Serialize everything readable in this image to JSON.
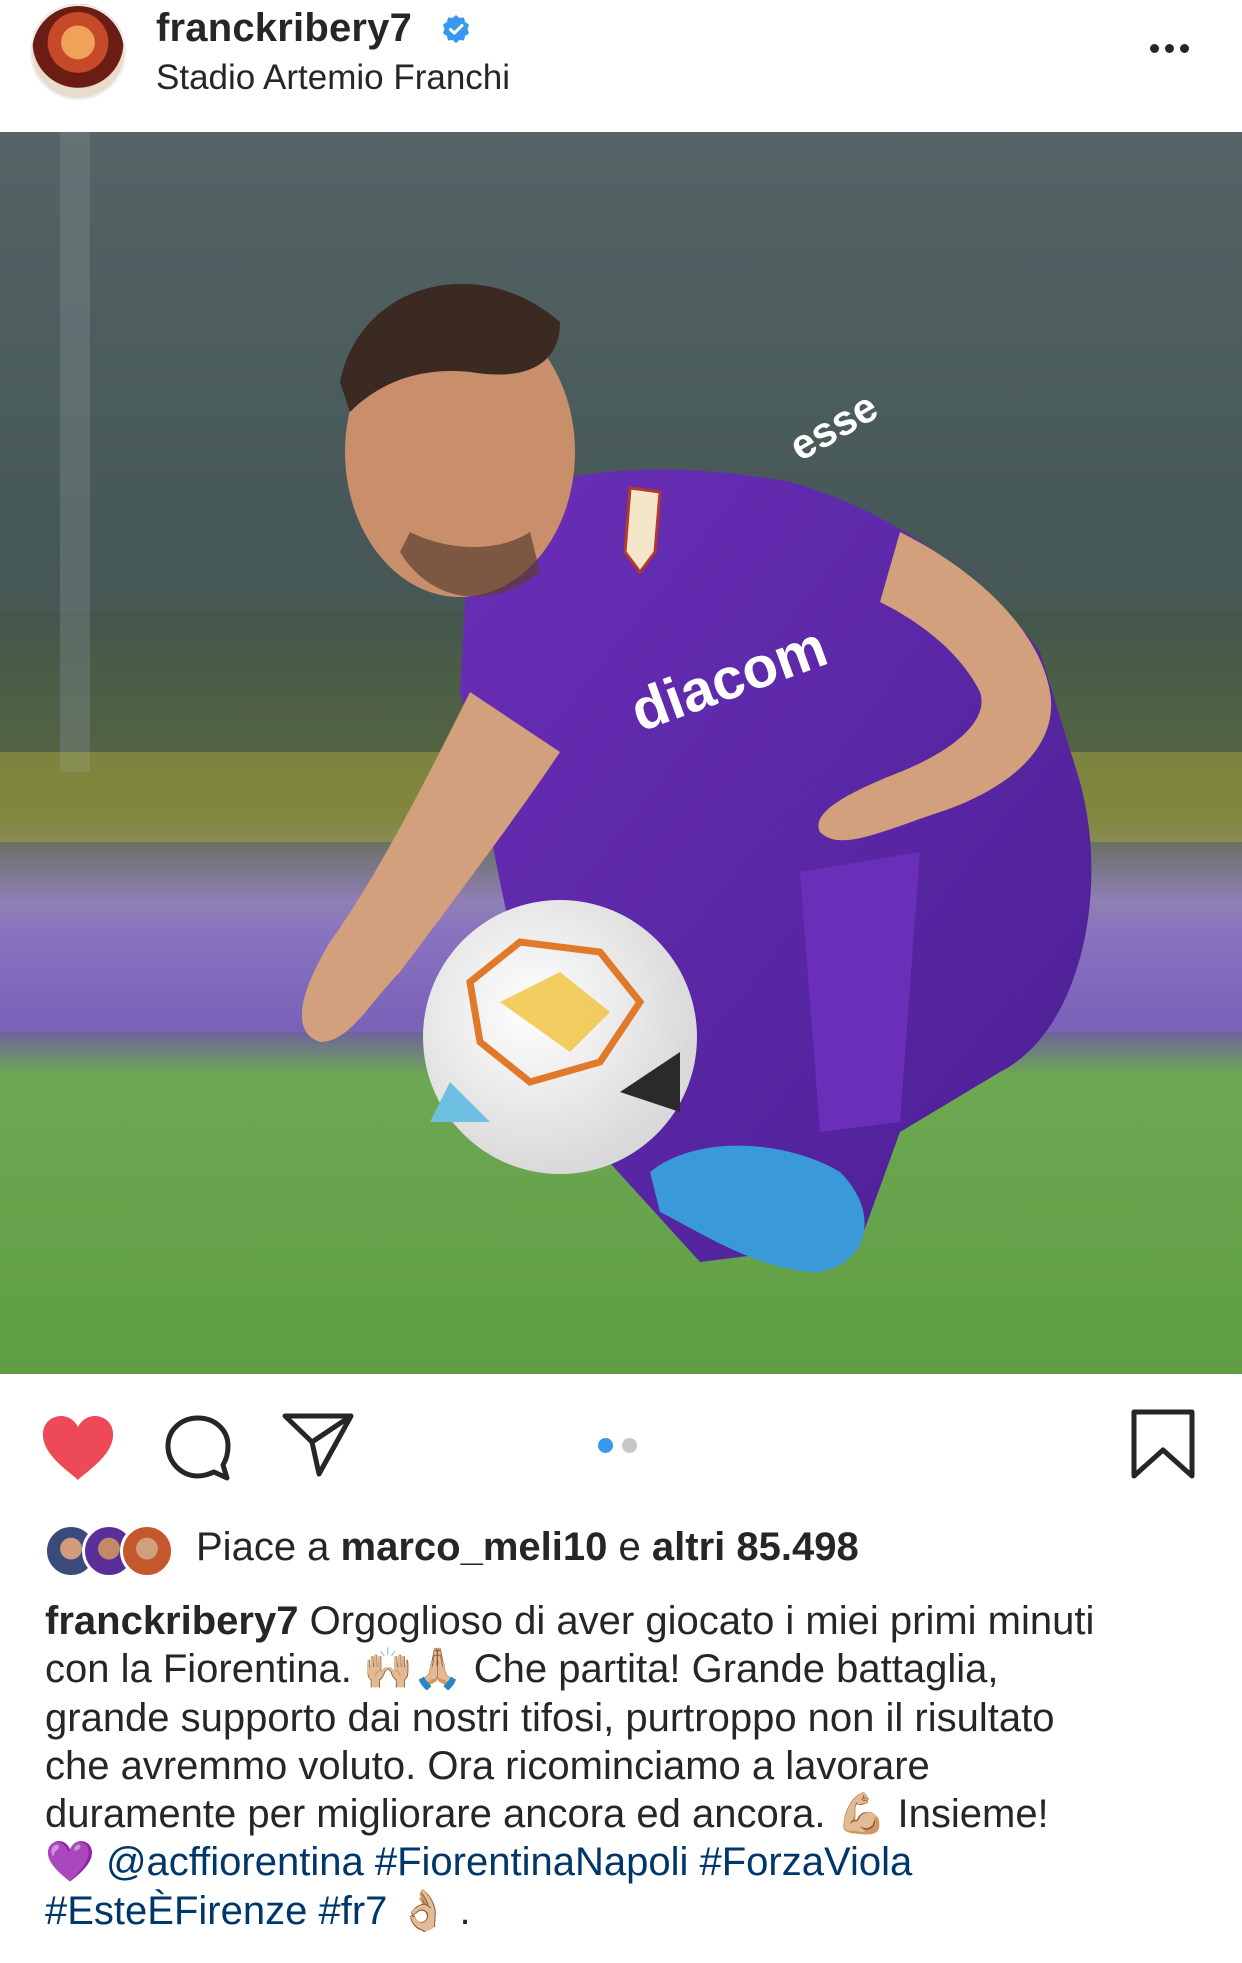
{
  "header": {
    "username": "franckribery7",
    "location": "Stadio Artemio Franchi",
    "verified": true
  },
  "post": {
    "photo_count": 2,
    "active_photo_index": 0,
    "liked": true,
    "colors": {
      "like_red": "#ed4956",
      "dot_active": "#3897f0",
      "dot_inactive": "#c7c7c7",
      "hashtag_blue": "#00376b"
    }
  },
  "likes": {
    "prefix": "Piace a",
    "first_user": "marco_meli10",
    "joiner": "e",
    "others": "altri 85.498"
  },
  "caption": {
    "author": "franckribery7",
    "line1": "Orgoglioso di aver giocato i miei primi minuti",
    "line2a": "con la Fiorentina.",
    "emoji1": "🙌🏼🙏🏼",
    "line2b": "Che partita! Grande battaglia,",
    "line3": "grande supporto dai nostri tifosi, purtroppo non il risultato",
    "line4": "che avremmo voluto. Ora ricominciamo a lavorare",
    "line5": "duramente per migliorare ancora ed ancora.",
    "emoji2": "💪🏼",
    "line5b": "Insieme!",
    "emoji3": "💜",
    "mention": "@acffiorentina",
    "tag1": "#FiorentinaNapoli",
    "tag2": "#ForzaViola",
    "tag3": "#EsteÈFirenze",
    "tag4": "#fr7",
    "emoji4": "👌🏼",
    "tail": "."
  },
  "icons": [
    "more-icon",
    "heart-icon",
    "comment-icon",
    "share-icon",
    "bookmark-icon",
    "verified-badge-icon"
  ]
}
